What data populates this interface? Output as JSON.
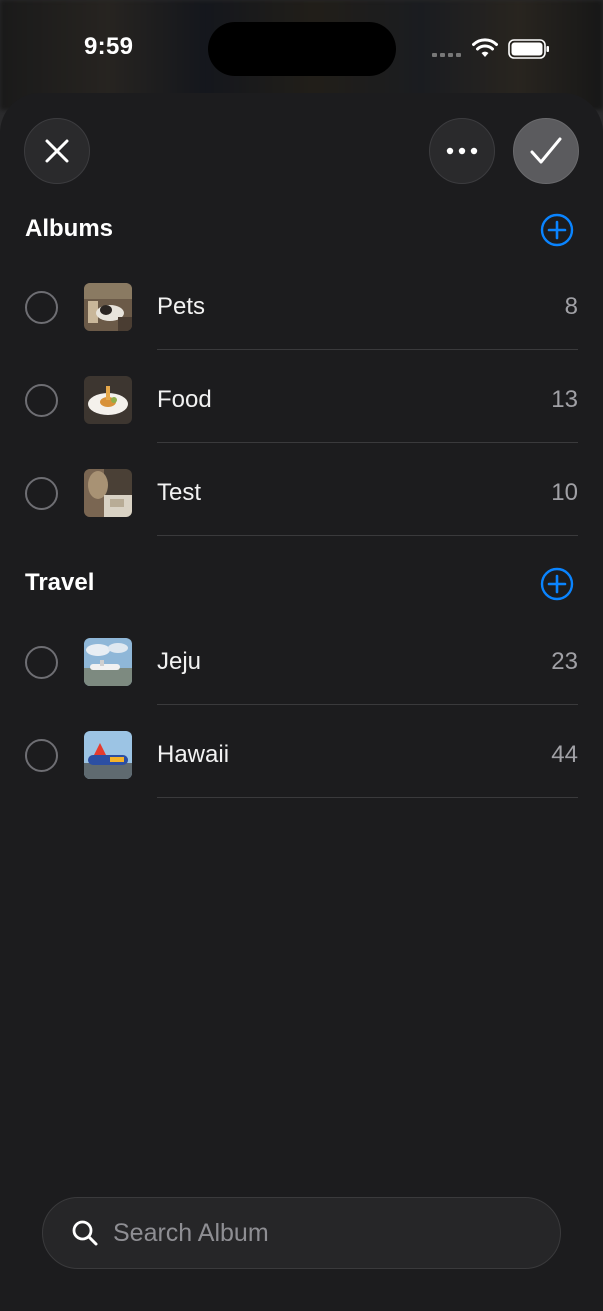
{
  "status": {
    "time": "9:59"
  },
  "toolbar": {
    "close_icon": "close-icon",
    "more_icon": "ellipsis-icon",
    "confirm_icon": "checkmark-icon"
  },
  "sections": [
    {
      "title": "Albums",
      "add_icon": "plus-circle-icon",
      "items": [
        {
          "name": "Pets",
          "count": "8"
        },
        {
          "name": "Food",
          "count": "13"
        },
        {
          "name": "Test",
          "count": "10"
        }
      ]
    },
    {
      "title": "Travel",
      "add_icon": "plus-circle-icon",
      "items": [
        {
          "name": "Jeju",
          "count": "23"
        },
        {
          "name": "Hawaii",
          "count": "44"
        }
      ]
    }
  ],
  "search": {
    "placeholder": "Search Album",
    "value": ""
  },
  "colors": {
    "accent": "#0a84ff",
    "sheet_background": "#1c1c1e",
    "secondary_text": "#a0a0a5"
  }
}
